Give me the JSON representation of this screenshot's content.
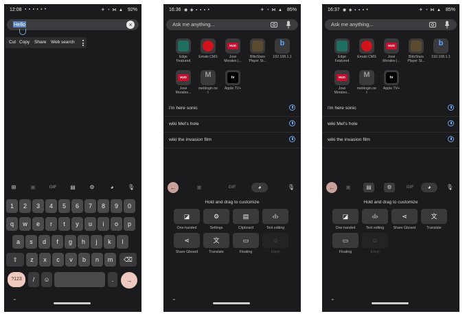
{
  "phone1": {
    "status": {
      "time": "12:08",
      "left_icons": "▪ ▪ ▪ ▪ ▪ •",
      "right_icons": "✈ ◔ ⋈ ▲",
      "battery": "92%"
    },
    "search": {
      "value": "Hello",
      "clear_icon": "close-icon"
    },
    "context_menu": {
      "items": [
        "Cut",
        "Copy",
        "Share",
        "Web search"
      ],
      "more_icon": "more-vert-icon"
    },
    "toolbar": {
      "items": [
        "grid-icon",
        "sticker-icon",
        "GIF",
        "clipboard-icon",
        "gear-icon",
        "palette-icon",
        "mic-icon"
      ],
      "gif_label": "GIF"
    },
    "keyboard": {
      "row1": [
        "1",
        "2",
        "3",
        "4",
        "5",
        "6",
        "7",
        "8",
        "9",
        "0"
      ],
      "row2": [
        "q",
        "w",
        "e",
        "r",
        "t",
        "y",
        "u",
        "i",
        "o",
        "p"
      ],
      "row3": [
        "a",
        "s",
        "d",
        "f",
        "g",
        "h",
        "j",
        "k",
        "l"
      ],
      "row4": [
        "⇧",
        "z",
        "x",
        "c",
        "v",
        "b",
        "n",
        "m",
        "⌫"
      ],
      "row5": {
        "numbers": "?123",
        "slash": "/",
        "emoji": "☺",
        "period": ".",
        "enter": "→"
      }
    },
    "nav": {
      "chevron": "⌄"
    }
  },
  "phone2": {
    "status": {
      "time": "16:36",
      "left_icons": "◉ ◈ ▪ ▪ ▪ •",
      "right_icons": "✈ ◔ ⋈ ▲",
      "battery": "85%"
    },
    "search": {
      "placeholder": "Ask me anything..."
    },
    "apps": [
      {
        "label": "Edge Featured"
      },
      {
        "label": "Emaki CMS"
      },
      {
        "label": "Jowi Morales |..."
      },
      {
        "label": "BlitzStars Player St..."
      },
      {
        "label": "192.168.1.1"
      },
      {
        "label": "Jowi Morales..."
      },
      {
        "label": "meblogin.ne t"
      },
      {
        "label": "Apple TV+"
      }
    ],
    "app_badges": {
      "hud": "HUD",
      "m": "M",
      "tv": "tv",
      "b": "b"
    },
    "suggestions": [
      "i'm here sonic",
      "wiki Mel's hole",
      "wiki the invasion film"
    ],
    "toolbar": {
      "gif_label": "GIF"
    },
    "hold_title": "Hold and drag to customize",
    "tiles": [
      {
        "label": "One-handed",
        "icon": "one-handed-icon",
        "glyph": "◪"
      },
      {
        "label": "Settings",
        "icon": "gear-icon",
        "glyph": "⚙"
      },
      {
        "label": "Clipboard",
        "icon": "clipboard-icon",
        "glyph": "▤"
      },
      {
        "label": "Text editing",
        "icon": "text-editing-icon",
        "glyph": "‹I›"
      },
      {
        "label": "Share Gboard",
        "icon": "share-icon",
        "glyph": "⋖"
      },
      {
        "label": "Translate",
        "icon": "translate-icon",
        "glyph": "文"
      },
      {
        "label": "Floating",
        "icon": "floating-icon",
        "glyph": "▭"
      },
      {
        "label": "Emoji",
        "icon": "emoji-icon",
        "glyph": "☺"
      }
    ],
    "nav": {
      "chevron": "⌄"
    }
  },
  "phone3": {
    "status": {
      "time": "16:37",
      "left_icons": "◉ ◈ ▪ ▪ ▪ •",
      "right_icons": "✈ ◔ ⋈ ▲",
      "battery": "85%"
    },
    "search": {
      "placeholder": "Ask me anything..."
    },
    "apps": [
      {
        "label": "Edge Featured"
      },
      {
        "label": "Emaki CMS"
      },
      {
        "label": "Jowi Morales |..."
      },
      {
        "label": "BlitzStars Player St..."
      },
      {
        "label": "192.168.1.1"
      },
      {
        "label": "Jowi Morales..."
      },
      {
        "label": "meblogin.ne t"
      },
      {
        "label": "Apple TV+"
      }
    ],
    "app_badges": {
      "hud": "HUD",
      "m": "M",
      "tv": "tv",
      "b": "b"
    },
    "suggestions": [
      "i'm here sonic",
      "wiki Mel's hole",
      "wiki the invasion film"
    ],
    "toolbar": {
      "gif_label": "GIF"
    },
    "hold_title": "Hold and drag to customize",
    "tiles": [
      {
        "label": "One-handed",
        "icon": "one-handed-icon",
        "glyph": "◪"
      },
      {
        "label": "Text editing",
        "icon": "text-editing-icon",
        "glyph": "‹I›"
      },
      {
        "label": "Share Gboard",
        "icon": "share-icon",
        "glyph": "⋖"
      },
      {
        "label": "Translate",
        "icon": "translate-icon",
        "glyph": "文"
      },
      {
        "label": "Floating",
        "icon": "floating-icon",
        "glyph": "▭"
      },
      {
        "label": "Emoji",
        "icon": "emoji-icon",
        "glyph": "☺"
      }
    ],
    "nav": {
      "chevron": "⌄"
    }
  },
  "colors": {
    "accent_key": "#f0c9c0",
    "history_icon": "#6fa8e8",
    "selection": "#5b86c4",
    "background": "#1b1b1d"
  }
}
